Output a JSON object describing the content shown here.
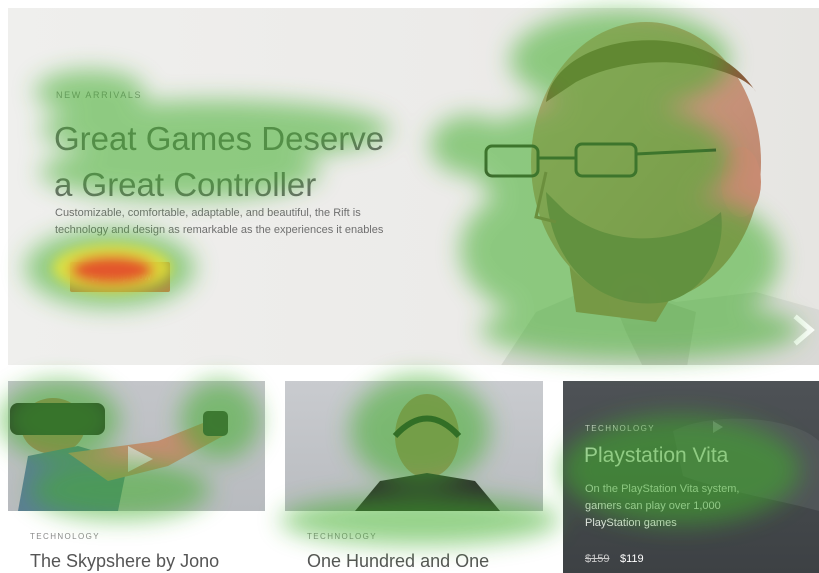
{
  "hero": {
    "eyebrow": "NEW ARRIVALS",
    "title_line1": "Great Games Deserve",
    "title_line2": "a Great Controller",
    "desc_line1": "Customizable, comfortable, adaptable, and beautiful, the Rift is",
    "desc_line2": "technology and design as remarkable as the experiences it enables",
    "button_label": "Shop Now",
    "button_icon": "cart-icon",
    "next_icon": "chevron-right-icon"
  },
  "cards": [
    {
      "tag": "TECHNOLOGY",
      "title": "The Skypshere by Jono"
    },
    {
      "tag": "TECHNOLOGY",
      "title": "One Hundred and One"
    },
    {
      "tag": "TECHNOLOGY",
      "title": "Playstation Vita",
      "desc_line1": "On the PlayStation Vita system,",
      "desc_line2": "gamers can play over 1,000",
      "desc_line3": "PlayStation games",
      "old_price": "$159",
      "new_price": "$119"
    }
  ],
  "colors": {
    "accent": "#f2795b",
    "heat_low": "#3fae2a",
    "heat_mid": "#e8e53a",
    "heat_high": "#e5342a"
  }
}
